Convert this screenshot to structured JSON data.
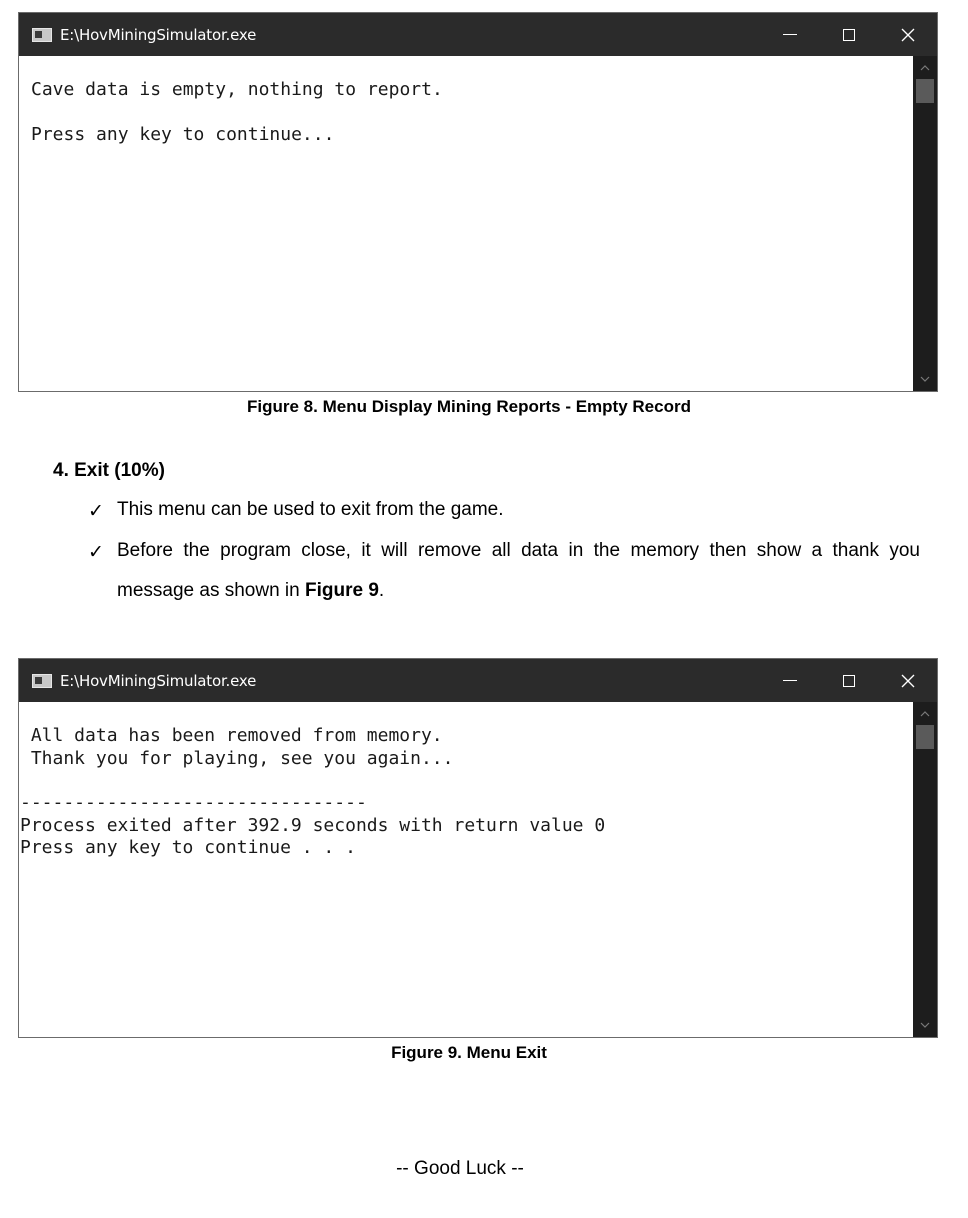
{
  "figure8": {
    "window_title": "E:\\HovMiningSimulator.exe",
    "lines": [
      "Cave data is empty, nothing to report.",
      "Press any key to continue..."
    ],
    "caption": "Figure 8. Menu Display Mining Reports - Empty Record"
  },
  "section": {
    "heading": "4.  Exit (10%)",
    "bullets": [
      {
        "check": "✓",
        "text": "This menu can be used to exit from the game."
      },
      {
        "check": "✓",
        "text_before": "Before the program close, it will remove all data in the memory then show a thank you message as shown in ",
        "text_bold": "Figure 9",
        "text_after": "."
      }
    ]
  },
  "figure9": {
    "window_title": "E:\\HovMiningSimulator.exe",
    "lines": [
      " All data has been removed from memory.",
      " Thank you for playing, see you again...",
      "--------------------------------",
      "Process exited after 392.9 seconds with return value 0",
      "Press any key to continue . . ."
    ],
    "caption": "Figure 9. Menu Exit"
  },
  "footer": {
    "good_luck": "-- Good Luck --"
  },
  "icons": {
    "app": "console-app-icon",
    "minimize": "minimize-icon",
    "maximize": "maximize-icon",
    "close": "close-icon",
    "scroll_up": "chevron-up-icon",
    "scroll_down": "chevron-down-icon",
    "check": "checkmark-icon"
  }
}
